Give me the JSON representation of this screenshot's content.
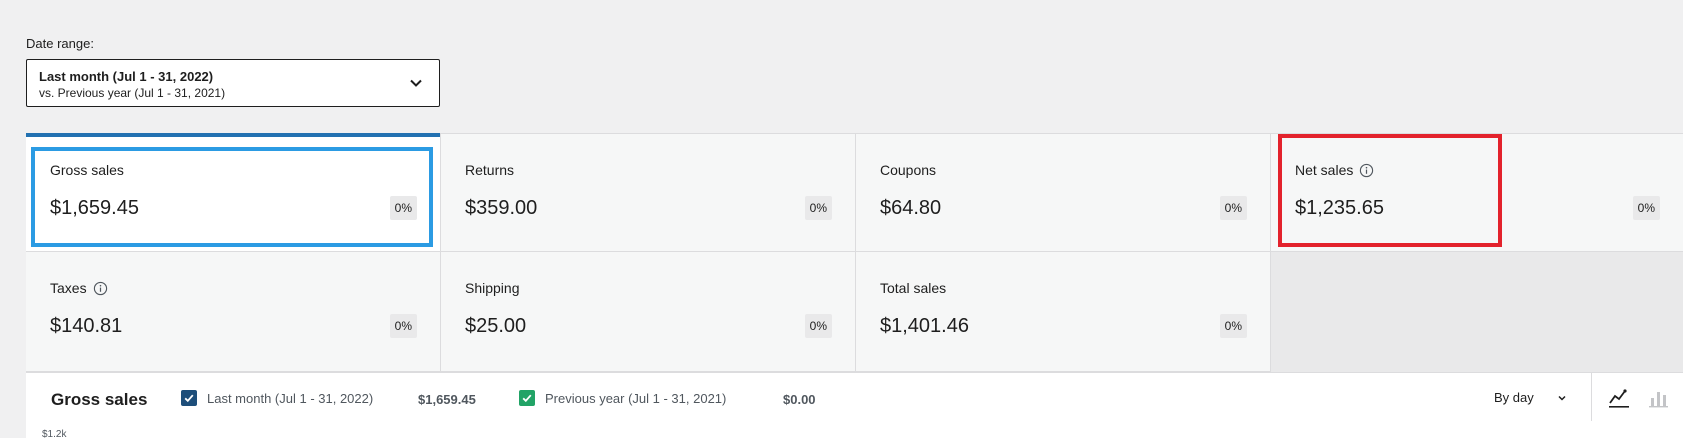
{
  "date_range": {
    "label": "Date range:",
    "primary": "Last month (Jul 1 - 31, 2022)",
    "secondary": "vs. Previous year (Jul 1 - 31, 2021)"
  },
  "tiles": [
    {
      "label": "Gross sales",
      "value": "$1,659.45",
      "delta": "0%"
    },
    {
      "label": "Returns",
      "value": "$359.00",
      "delta": "0%"
    },
    {
      "label": "Coupons",
      "value": "$64.80",
      "delta": "0%"
    },
    {
      "label": "Net sales",
      "value": "$1,235.65",
      "delta": "0%"
    },
    {
      "label": "Taxes",
      "value": "$140.81",
      "delta": "0%"
    },
    {
      "label": "Shipping",
      "value": "$25.00",
      "delta": "0%"
    },
    {
      "label": "Total sales",
      "value": "$1,401.46",
      "delta": "0%"
    }
  ],
  "chart": {
    "title": "Gross sales",
    "legend": [
      {
        "label": "Last month (Jul 1 - 31, 2022)",
        "total": "$1,659.45",
        "color": "#1d4e7a"
      },
      {
        "label": "Previous year (Jul 1 - 31, 2021)",
        "total": "$0.00",
        "color": "#21a366"
      }
    ],
    "interval": "By day",
    "axis_top": "$1.2k"
  },
  "colors": {
    "accent": "#2271b1",
    "highlight_blue": "#2b9be3",
    "highlight_red": "#e3222c"
  }
}
